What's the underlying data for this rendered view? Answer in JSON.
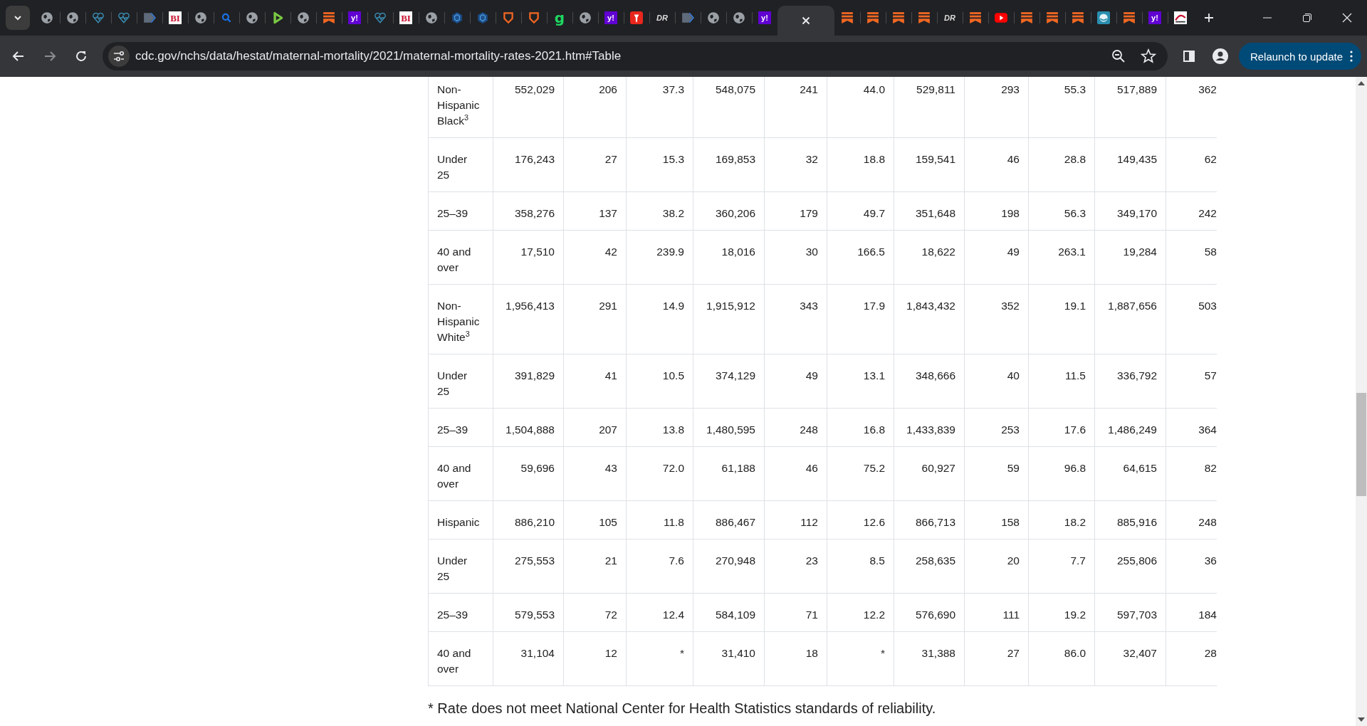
{
  "browser": {
    "tabs": [
      {
        "kind": "globe",
        "selected": false
      },
      {
        "kind": "globe",
        "selected": false
      },
      {
        "kind": "heart",
        "selected": false
      },
      {
        "kind": "heart",
        "selected": false
      },
      {
        "kind": "arrow",
        "selected": false
      },
      {
        "kind": "bi",
        "mark": "BI",
        "selected": false
      },
      {
        "kind": "globe",
        "selected": false
      },
      {
        "kind": "search",
        "selected": false
      },
      {
        "kind": "globe",
        "selected": false
      },
      {
        "kind": "play",
        "selected": false
      },
      {
        "kind": "globe",
        "selected": false
      },
      {
        "kind": "bookmark",
        "selected": false
      },
      {
        "kind": "yahoo",
        "mark": "y!",
        "selected": false
      },
      {
        "kind": "heart",
        "selected": false
      },
      {
        "kind": "bi",
        "mark": "BI",
        "selected": false
      },
      {
        "kind": "globe",
        "selected": false
      },
      {
        "kind": "hex",
        "selected": false
      },
      {
        "kind": "hex",
        "selected": false
      },
      {
        "kind": "shield",
        "selected": false
      },
      {
        "kind": "shield",
        "selected": false
      },
      {
        "kind": "g",
        "mark": "g",
        "selected": false
      },
      {
        "kind": "globe",
        "selected": false
      },
      {
        "kind": "yahoo",
        "mark": "y!",
        "selected": false
      },
      {
        "kind": "pin",
        "selected": false
      },
      {
        "kind": "dr",
        "mark": "DR",
        "selected": false
      },
      {
        "kind": "arrow",
        "selected": false
      },
      {
        "kind": "globe",
        "selected": false
      },
      {
        "kind": "globe",
        "selected": false
      },
      {
        "kind": "yahoo",
        "mark": "y!",
        "selected": false
      },
      {
        "kind": "blank",
        "selected": true
      },
      {
        "kind": "bookmark",
        "selected": false
      },
      {
        "kind": "bookmark",
        "selected": false
      },
      {
        "kind": "bookmark",
        "selected": false
      },
      {
        "kind": "bookmark",
        "selected": false
      },
      {
        "kind": "dr",
        "mark": "DR",
        "selected": false
      },
      {
        "kind": "bookmark",
        "selected": false
      },
      {
        "kind": "youtube",
        "selected": false
      },
      {
        "kind": "bookmark",
        "selected": false
      },
      {
        "kind": "bookmark",
        "selected": false
      },
      {
        "kind": "bookmark",
        "selected": false
      },
      {
        "kind": "face",
        "selected": false
      },
      {
        "kind": "bookmark",
        "selected": false
      },
      {
        "kind": "yahoo",
        "mark": "y!",
        "selected": false
      },
      {
        "kind": "chart",
        "selected": false
      }
    ],
    "url": "cdc.gov/nchs/data/hestat/maternal-mortality/2021/maternal-mortality-rates-2021.htm#Table",
    "update_button": "Relaunch to update"
  },
  "table": {
    "rows": [
      {
        "cells": [
          "Non-Hispanic Black$^{3}$",
          "552,029",
          "206",
          "37.3",
          "548,075",
          "241",
          "44.0",
          "529,811",
          "293",
          "55.3",
          "517,889",
          "362"
        ]
      },
      {
        "cells": [
          "Under 25",
          "176,243",
          "27",
          "15.3",
          "169,853",
          "32",
          "18.8",
          "159,541",
          "46",
          "28.8",
          "149,435",
          "62"
        ]
      },
      {
        "cells": [
          "25–39",
          "358,276",
          "137",
          "38.2",
          "360,206",
          "179",
          "49.7",
          "351,648",
          "198",
          "56.3",
          "349,170",
          "242"
        ]
      },
      {
        "cells": [
          "40 and over",
          "17,510",
          "42",
          "239.9",
          "18,016",
          "30",
          "166.5",
          "18,622",
          "49",
          "263.1",
          "19,284",
          "58"
        ]
      },
      {
        "cells": [
          "Non-Hispanic White$^{3}$",
          "1,956,413",
          "291",
          "14.9",
          "1,915,912",
          "343",
          "17.9",
          "1,843,432",
          "352",
          "19.1",
          "1,887,656",
          "503"
        ]
      },
      {
        "cells": [
          "Under 25",
          "391,829",
          "41",
          "10.5",
          "374,129",
          "49",
          "13.1",
          "348,666",
          "40",
          "11.5",
          "336,792",
          "57"
        ]
      },
      {
        "cells": [
          "25–39",
          "1,504,888",
          "207",
          "13.8",
          "1,480,595",
          "248",
          "16.8",
          "1,433,839",
          "253",
          "17.6",
          "1,486,249",
          "364"
        ]
      },
      {
        "cells": [
          "40 and over",
          "59,696",
          "43",
          "72.0",
          "61,188",
          "46",
          "75.2",
          "60,927",
          "59",
          "96.8",
          "64,615",
          "82"
        ]
      },
      {
        "cells": [
          "Hispanic",
          "886,210",
          "105",
          "11.8",
          "886,467",
          "112",
          "12.6",
          "866,713",
          "158",
          "18.2",
          "885,916",
          "248"
        ]
      },
      {
        "cells": [
          "Under 25",
          "275,553",
          "21",
          "7.6",
          "270,948",
          "23",
          "8.5",
          "258,635",
          "20",
          "7.7",
          "255,806",
          "36"
        ]
      },
      {
        "cells": [
          "25–39",
          "579,553",
          "72",
          "12.4",
          "584,109",
          "71",
          "12.2",
          "576,690",
          "111",
          "19.2",
          "597,703",
          "184"
        ]
      },
      {
        "cells": [
          "40 and over",
          "31,104",
          "12",
          "*",
          "31,410",
          "18",
          "*",
          "31,388",
          "27",
          "86.0",
          "32,407",
          "28"
        ]
      }
    ]
  },
  "footnote": "* Rate does not meet National Center for Health Statistics standards of reliability."
}
